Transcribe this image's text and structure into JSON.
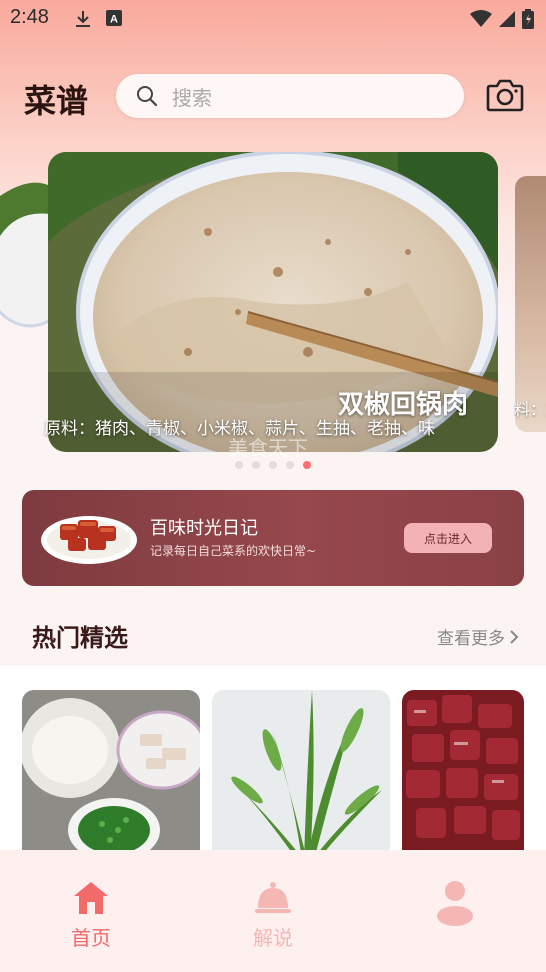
{
  "status_bar": {
    "time": "2:48"
  },
  "header": {
    "title": "菜谱",
    "search_placeholder": "搜索"
  },
  "banner": {
    "title": "双椒回锅肉",
    "ingredients": "原料：猪肉、青椒、小米椒、蒜片、生抽、老抽、味",
    "watermark": "美食天下",
    "next_peek_text": "料：鸡",
    "dots_count": 5,
    "active_dot": 4
  },
  "diary": {
    "title": "百味时光日记",
    "subtitle": "记录每日自己菜系的欢快日常~",
    "button": "点击进入"
  },
  "hot_section": {
    "title": "热门精选",
    "see_more": "查看更多"
  },
  "bottom_nav": {
    "items": [
      {
        "label": "首页",
        "active": true
      },
      {
        "label": "解说",
        "active": false
      },
      {
        "label": "",
        "active": false
      }
    ]
  },
  "colors": {
    "accent": "#ff6f6f",
    "nav_active": "#f26a6a",
    "nav_inactive": "#f5b7b4",
    "diary_bg": "#8a4146"
  }
}
